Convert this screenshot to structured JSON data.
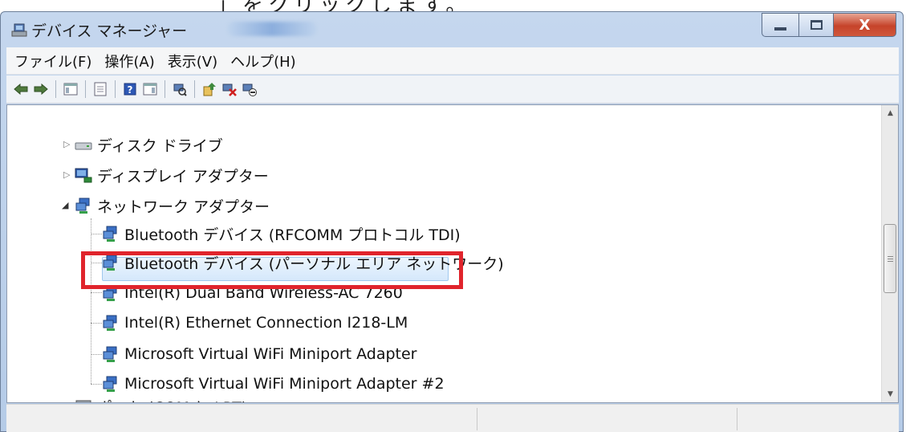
{
  "window": {
    "title": "デバイス マネージャー",
    "icons": {
      "app": "device-manager-icon",
      "minimize": "minimize-icon",
      "maximize": "maximize-icon",
      "close": "close-icon"
    },
    "close_glyph": "X"
  },
  "menu": [
    {
      "label": "ファイル(F)"
    },
    {
      "label": "操作(A)"
    },
    {
      "label": "表示(V)"
    },
    {
      "label": "ヘルプ(H)"
    }
  ],
  "toolbar": [
    "back-icon",
    "forward-icon",
    "show-hide-console-tree-icon",
    "properties-icon",
    "help-icon",
    "show-hide-action-pane-icon",
    "scan-hardware-changes-icon",
    "update-driver-icon",
    "uninstall-icon",
    "disable-device-icon"
  ],
  "tree": {
    "categories": [
      {
        "label": "ディスク ドライブ",
        "icon": "disk-drive-icon",
        "expanded": false
      },
      {
        "label": "ディスプレイ アダプター",
        "icon": "display-adapter-icon",
        "expanded": false
      },
      {
        "label": "ネットワーク アダプター",
        "icon": "network-adapter-icon",
        "expanded": true
      }
    ],
    "network_devices": [
      {
        "label": "Bluetooth デバイス (RFCOMM プロトコル TDI)"
      },
      {
        "label": "Bluetooth デバイス (パーソナル エリア ネットワーク)"
      },
      {
        "label": "Intel(R) Dual Band Wireless-AC 7260",
        "selected": true
      },
      {
        "label": "Intel(R) Ethernet Connection I218-LM"
      },
      {
        "label": "Microsoft Virtual WiFi Miniport Adapter"
      },
      {
        "label": "Microsoft Virtual WiFi Miniport Adapter #2"
      }
    ],
    "partial_next_label": "ポート (COM と LPT)"
  },
  "annotation": {
    "highlight_color": "#e0242c"
  },
  "colors": {
    "titlebar": "#c5d7ee",
    "selection": "#d5e8fb",
    "close_button": "#c6432a"
  }
}
